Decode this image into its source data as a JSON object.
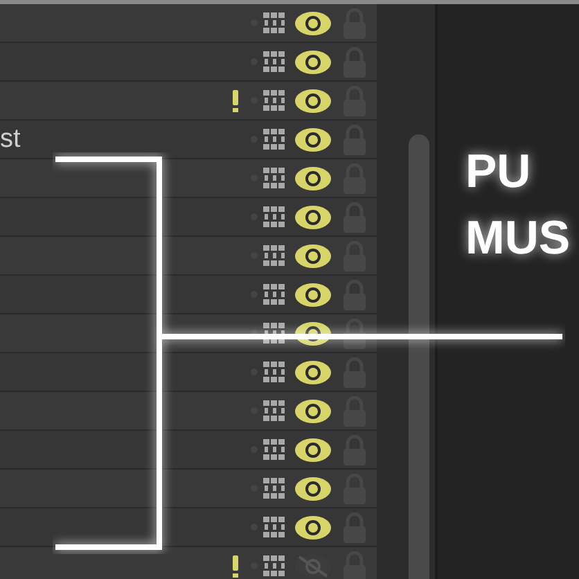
{
  "layers": [
    {
      "warning": false,
      "visible": true,
      "locked": false
    },
    {
      "warning": false,
      "visible": true,
      "locked": false
    },
    {
      "warning": true,
      "visible": true,
      "locked": false
    },
    {
      "label": "st",
      "warning": false,
      "visible": true,
      "locked": false
    },
    {
      "warning": false,
      "visible": true,
      "locked": false
    },
    {
      "warning": false,
      "visible": true,
      "locked": false
    },
    {
      "warning": false,
      "visible": true,
      "locked": false
    },
    {
      "warning": false,
      "visible": true,
      "locked": false
    },
    {
      "warning": false,
      "visible": true,
      "locked": false
    },
    {
      "warning": false,
      "visible": true,
      "locked": false
    },
    {
      "warning": false,
      "visible": true,
      "locked": false
    },
    {
      "warning": false,
      "visible": true,
      "locked": false
    },
    {
      "warning": false,
      "visible": true,
      "locked": false
    },
    {
      "warning": false,
      "visible": true,
      "locked": false
    },
    {
      "warning": true,
      "visible": false,
      "locked": false
    }
  ],
  "annotation": {
    "lines": [
      "PU",
      "MUS"
    ]
  }
}
